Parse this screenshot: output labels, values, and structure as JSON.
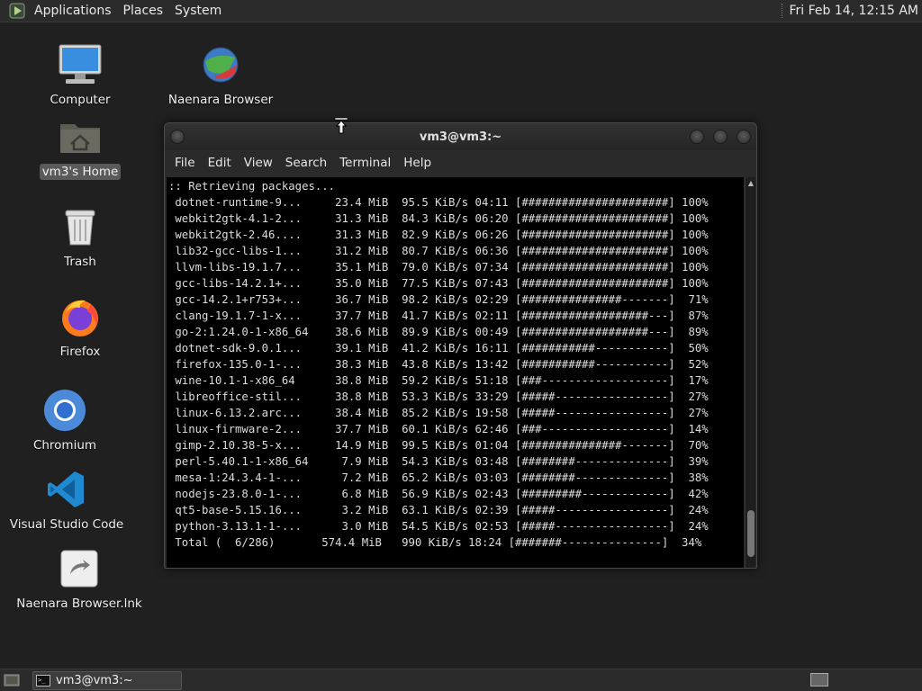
{
  "top_panel": {
    "menus": [
      "Applications",
      "Places",
      "System"
    ],
    "clock": "Fri Feb 14, 12:15 AM"
  },
  "desktop_icons": {
    "computer": "Computer",
    "browser": "Naenara Browser",
    "home": "vm3's Home",
    "trash": "Trash",
    "firefox": "Firefox",
    "chromium": "Chromium",
    "vscode": "Visual Studio Code",
    "browser_lnk": "Naenara Browser.lnk"
  },
  "terminal": {
    "title": "vm3@vm3:~",
    "menu": [
      "File",
      "Edit",
      "View",
      "Search",
      "Terminal",
      "Help"
    ],
    "lines": [
      ":: Retrieving packages...",
      " dotnet-runtime-9...     23.4 MiB  95.5 KiB/s 04:11 [######################] 100%",
      " webkit2gtk-4.1-2...     31.3 MiB  84.3 KiB/s 06:20 [######################] 100%",
      " webkit2gtk-2.46....     31.3 MiB  82.9 KiB/s 06:26 [######################] 100%",
      " lib32-gcc-libs-1...     31.2 MiB  80.7 KiB/s 06:36 [######################] 100%",
      " llvm-libs-19.1.7...     35.1 MiB  79.0 KiB/s 07:34 [######################] 100%",
      " gcc-libs-14.2.1+...     35.0 MiB  77.5 KiB/s 07:43 [######################] 100%",
      " gcc-14.2.1+r753+...     36.7 MiB  98.2 KiB/s 02:29 [###############-------]  71%",
      " clang-19.1.7-1-x...     37.7 MiB  41.7 KiB/s 02:11 [###################---]  87%",
      " go-2:1.24.0-1-x86_64    38.6 MiB  89.9 KiB/s 00:49 [###################---]  89%",
      " dotnet-sdk-9.0.1...     39.1 MiB  41.2 KiB/s 16:11 [###########-----------]  50%",
      " firefox-135.0-1-...     38.3 MiB  43.8 KiB/s 13:42 [###########-----------]  52%",
      " wine-10.1-1-x86_64      38.8 MiB  59.2 KiB/s 51:18 [###-------------------]  17%",
      " libreoffice-stil...     38.8 MiB  53.3 KiB/s 33:29 [#####-----------------]  27%",
      " linux-6.13.2.arc...     38.4 MiB  85.2 KiB/s 19:58 [#####-----------------]  27%",
      " linux-firmware-2...     37.7 MiB  60.1 KiB/s 62:46 [###-------------------]  14%",
      " gimp-2.10.38-5-x...     14.9 MiB  99.5 KiB/s 01:04 [###############-------]  70%",
      " perl-5.40.1-1-x86_64     7.9 MiB  54.3 KiB/s 03:48 [########--------------]  39%",
      " mesa-1:24.3.4-1-...      7.2 MiB  65.2 KiB/s 03:03 [########--------------]  38%",
      " nodejs-23.8.0-1-...      6.8 MiB  56.9 KiB/s 02:43 [#########-------------]  42%",
      " qt5-base-5.15.16...      3.2 MiB  63.1 KiB/s 02:39 [#####-----------------]  24%",
      " python-3.13.1-1-...      3.0 MiB  54.5 KiB/s 02:53 [#####-----------------]  24%",
      " Total (  6/286)       574.4 MiB   990 KiB/s 18:24 [#######---------------]  34%"
    ]
  },
  "taskbar": {
    "task_label": "vm3@vm3:~"
  }
}
